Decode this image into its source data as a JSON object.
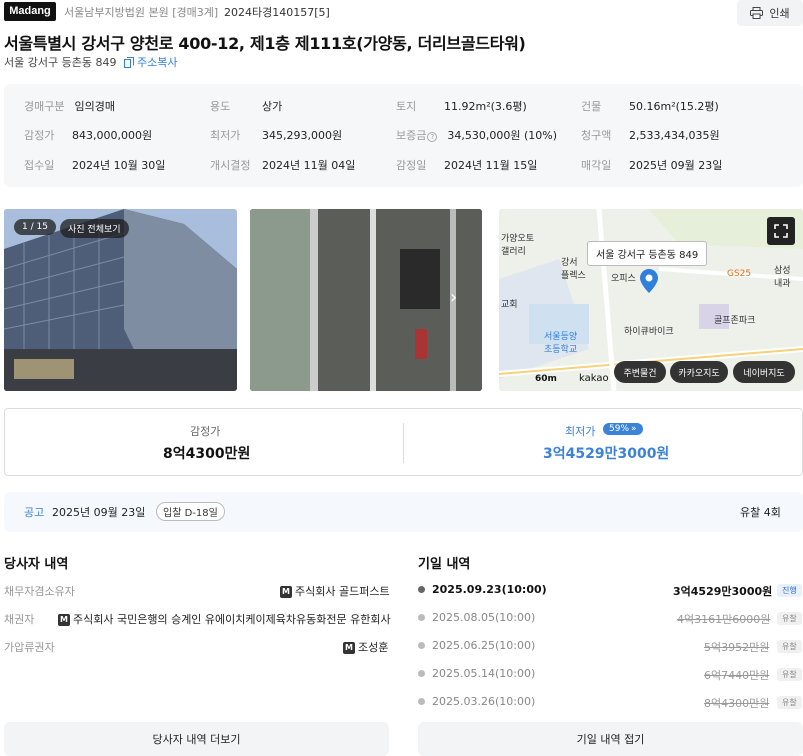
{
  "header": {
    "logo": "Madang",
    "court": "서울남부지방법원 본원 [경매3계]",
    "case_no": "2024타경140157[5]",
    "print_label": "인쇄"
  },
  "title": "서울특별시 강서구 양천로 400-12, 제1층 제111호(가양동, 더리브골드타워)",
  "jibun": "서울 강서구 등촌동 849",
  "copy_label": "주소복사",
  "info": {
    "row1": [
      {
        "k": "경매구분",
        "v": "임의경매"
      },
      {
        "k": "용도",
        "v": "상가"
      },
      {
        "k": "토지",
        "v": "11.92m²(3.6평)"
      },
      {
        "k": "건물",
        "v": "50.16m²(15.2평)"
      }
    ],
    "row2": [
      {
        "k": "감정가",
        "v": "843,000,000원"
      },
      {
        "k": "최저가",
        "v": "345,293,000원"
      },
      {
        "k": "보증금",
        "v": "34,530,000원 (10%)"
      },
      {
        "k": "청구액",
        "v": "2,533,434,035원"
      }
    ],
    "row3": [
      {
        "k": "접수일",
        "v": "2024년 10월 30일"
      },
      {
        "k": "개시결정",
        "v": "2024년 11월 04일"
      },
      {
        "k": "감정일",
        "v": "2024년 11월 15일"
      },
      {
        "k": "매각일",
        "v": "2025년 09월 23일"
      }
    ]
  },
  "photos": {
    "counter": "1 / 15",
    "all_label": "사진 전체보기"
  },
  "map": {
    "tooltip": "서울 강서구 등촌동 849",
    "labels": [
      "가양오토",
      "갤러리",
      "강서",
      "플렉스",
      "오피스",
      "GS25",
      "삼성",
      "내과",
      "하이큐바이크",
      "골프존파크",
      "서울등양",
      "초등학교",
      "교회"
    ],
    "scale": "60m",
    "brand": "kakao",
    "btn_around": "주변물건",
    "btn_kakao": "카카오지도",
    "btn_naver": "네이버지도"
  },
  "prices": {
    "appraisal_label": "감정가",
    "appraisal": "8억4300만원",
    "min_label": "최저가",
    "min_pct": "59%",
    "min": "3억4529만3000원"
  },
  "notice": {
    "label": "공고",
    "date": "2025년 09월 23일",
    "badge": "입찰 D-18일",
    "fail": "유찰 4회"
  },
  "parties": {
    "title": "당사자 내역",
    "rows": [
      {
        "k": "채무자겸소유자",
        "v": "주식회사 골드퍼스트"
      },
      {
        "k": "채권자",
        "v": "주식회사 국민은행의 승계인 유에이치케이제육차유동화전문 유한회사"
      },
      {
        "k": "가압류권자",
        "v": "조성훈"
      }
    ],
    "more": "당사자 내역 더보기"
  },
  "schedule": {
    "title": "기일 내역",
    "rows": [
      {
        "date": "2025.09.23(10:00)",
        "price": "3억4529만3000원",
        "status": "진행"
      },
      {
        "date": "2025.08.05(10:00)",
        "price": "4억3161만6000원",
        "status": "유찰"
      },
      {
        "date": "2025.06.25(10:00)",
        "price": "5억3952만원",
        "status": "유찰"
      },
      {
        "date": "2025.05.14(10:00)",
        "price": "6억7440만원",
        "status": "유찰"
      },
      {
        "date": "2025.03.26(10:00)",
        "price": "8억4300만원",
        "status": "유찰"
      }
    ],
    "fold": "기일 내역 접기"
  },
  "colors": {
    "accent": "#3b82d9",
    "active": "#2f6fd0"
  }
}
